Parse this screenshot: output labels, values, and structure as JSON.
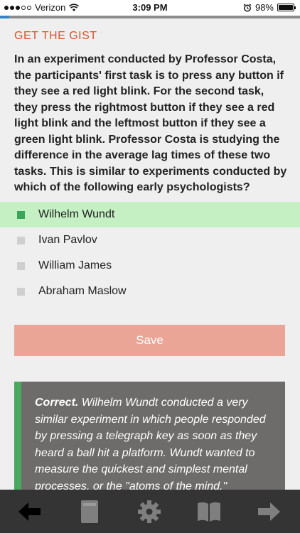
{
  "status_bar": {
    "carrier": "Verizon",
    "time": "3:09 PM",
    "battery": "98%"
  },
  "progress": {
    "fraction": 0.03
  },
  "section_label": "GET THE GIST",
  "question": "In an experiment conducted by Professor Costa, the participants' first task is to press any button if they see a red light blink. For the second task, they press the rightmost button if they see a red light blink and the leftmost button if they see a green light blink. Professor Costa is studying the difference in the average lag times of these two tasks. This is similar to experiments conducted by which of the following early psychologists?",
  "options": [
    {
      "label": "Wilhelm Wundt",
      "selected": true
    },
    {
      "label": "Ivan Pavlov",
      "selected": false
    },
    {
      "label": "William James",
      "selected": false
    },
    {
      "label": "Abraham Maslow",
      "selected": false
    }
  ],
  "save_label": "Save",
  "feedback": {
    "verdict": "Correct.",
    "text": " Wilhelm Wundt conducted a very similar experiment in which people responded by pressing a telegraph key as soon as they heard a ball hit a platform. Wundt wanted to measure the quickest and simplest mental processes, or the \"atoms of the mind.\""
  },
  "nav": {
    "items": [
      "arrow-left-icon",
      "book-icon",
      "gear-icon",
      "open-book-icon",
      "arrow-right-icon"
    ]
  },
  "colors": {
    "accent": "#d9542c",
    "selected_bg": "#c4f0c3",
    "checkbox_selected": "#3aa65a",
    "save_bg": "#eaa596",
    "feedback_bg": "#6e6c6a",
    "feedback_bar": "#49a95e",
    "nav_bg": "#343434",
    "progress": "#2f86c8"
  }
}
